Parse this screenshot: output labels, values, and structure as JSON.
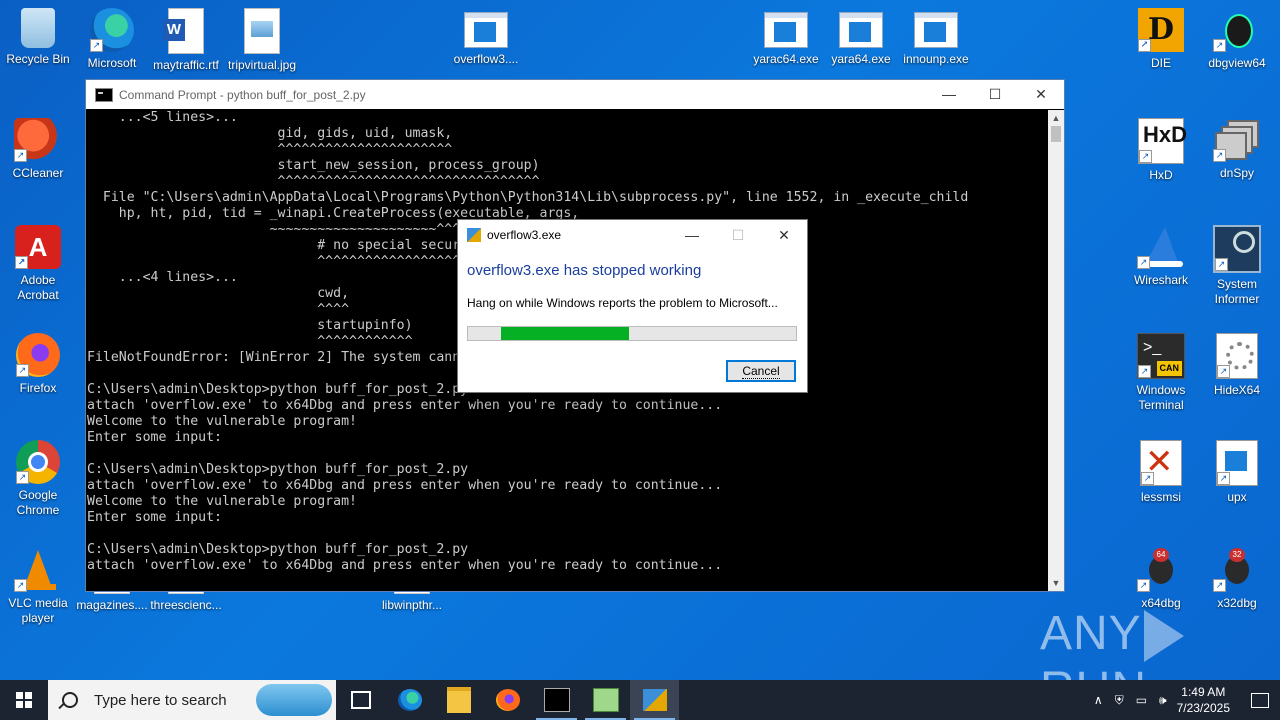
{
  "desktop": {
    "icons": {
      "recycle_bin": "Recycle Bin",
      "edge": "Microsoft Edge",
      "maytraffic": "maytraffic.rtf",
      "tripvirtual": "tripvirtual.jpg",
      "overflow3": "overflow3....",
      "yarac64": "yarac64.exe",
      "yara64": "yara64.exe",
      "innounp": "innounp.exe",
      "die": "DIE",
      "dbgview64": "dbgview64",
      "ccleaner": "CCleaner",
      "hxd": "HxD",
      "dnspy": "dnSpy",
      "adobe": "Adobe Acrobat",
      "wireshark": "Wireshark",
      "sysinformer": "System Informer",
      "firefox": "Firefox",
      "winterminal": "Windows Terminal",
      "hidex64": "HideX64",
      "chrome": "Google Chrome",
      "lessmsi": "lessmsi",
      "upx": "upx",
      "vlc": "VLC media player",
      "magazines": "magazines....",
      "threescience": "threescienc...",
      "libwinpthr": "libwinpthr...",
      "x64dbg": "x64dbg",
      "x32dbg": "x32dbg"
    },
    "watermark": "ANY RUN"
  },
  "cmd_window": {
    "title": "Command Prompt - python  buff_for_post_2.py",
    "lines": [
      "    ...<5 lines>...",
      "                        gid, gids, uid, umask,",
      "                        ^^^^^^^^^^^^^^^^^^^^^^",
      "                        start_new_session, process_group)",
      "                        ^^^^^^^^^^^^^^^^^^^^^^^^^^^^^^^^^",
      "  File \"C:\\Users\\admin\\AppData\\Local\\Programs\\Python\\Python314\\Lib\\subprocess.py\", line 1552, in _execute_child",
      "    hp, ht, pid, tid = _winapi.CreateProcess(executable, args,",
      "                       ~~~~~~~~~~~~~~~~~~~~~^^^^^^^^^^^^^^^^^^",
      "                             # no special security",
      "                             ^^^^^^^^^^^^^^^^^^^^^",
      "    ...<4 lines>...",
      "                             cwd,",
      "                             ^^^^",
      "                             startupinfo)",
      "                             ^^^^^^^^^^^^",
      "FileNotFoundError: [WinError 2] The system cannot find the file specified",
      "",
      "C:\\Users\\admin\\Desktop>python buff_for_post_2.py",
      "attach 'overflow.exe' to x64Dbg and press enter when you're ready to continue...",
      "Welcome to the vulnerable program!",
      "Enter some input:",
      "",
      "C:\\Users\\admin\\Desktop>python buff_for_post_2.py",
      "attach 'overflow.exe' to x64Dbg and press enter when you're ready to continue...",
      "Welcome to the vulnerable program!",
      "Enter some input:",
      "",
      "C:\\Users\\admin\\Desktop>python buff_for_post_2.py",
      "attach 'overflow.exe' to x64Dbg and press enter when you're ready to continue..."
    ]
  },
  "dialog": {
    "title": "overflow3.exe",
    "heading": "overflow3.exe has stopped working",
    "message": "Hang on while Windows reports the problem to Microsoft...",
    "progress_fraction_start": 0.1,
    "progress_fraction_end": 0.49,
    "cancel_label": "Cancel"
  },
  "taskbar": {
    "search_placeholder": "Type here to search",
    "time": "1:49 AM",
    "date": "7/23/2025"
  },
  "colors": {
    "desktop_bg": "#0b78dd",
    "dialog_heading": "#1a3e9f",
    "progress": "#06b025",
    "taskbar": "#1c2432"
  }
}
